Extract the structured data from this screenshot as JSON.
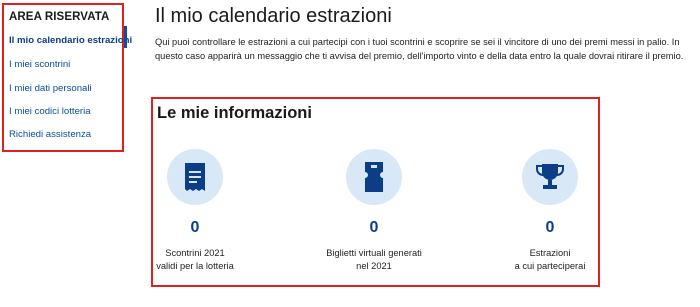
{
  "sidebar": {
    "title": "AREA RISERVATA",
    "items": [
      {
        "label": "Il mio calendario estrazioni",
        "active": true
      },
      {
        "label": "I miei scontrini",
        "active": false
      },
      {
        "label": "I miei dati personali",
        "active": false
      },
      {
        "label": "I miei codici lotteria",
        "active": false
      },
      {
        "label": "Richiedi assistenza",
        "active": false
      }
    ]
  },
  "main": {
    "title": "Il mio calendario estrazioni",
    "intro": "Qui puoi controllare le estrazioni a cui partecipi con i tuoi scontrini e scoprire se sei il vincitore di uno dei premi messi in palio. In questo caso apparirà un messaggio che ti avvisa del premio, dell'importo vinto e della data entro la quale dovrai ritirare il premio."
  },
  "info": {
    "title": "Le mie informazioni",
    "stats": [
      {
        "icon": "receipt-icon",
        "count": "0",
        "label_line1": "Scontrini 2021",
        "label_line2": "validi per la lotteria"
      },
      {
        "icon": "ticket-icon",
        "count": "0",
        "label_line1": "Biglietti virtuali generati",
        "label_line2": "nel 2021"
      },
      {
        "icon": "trophy-icon",
        "count": "0",
        "label_line1": "Estrazioni",
        "label_line2": "a cui parteciperai"
      }
    ]
  },
  "colors": {
    "accent": "#0a4fa0",
    "count": "#0b3e86",
    "icon_bg": "#d9e8f6",
    "highlight_border": "#e0201f"
  }
}
